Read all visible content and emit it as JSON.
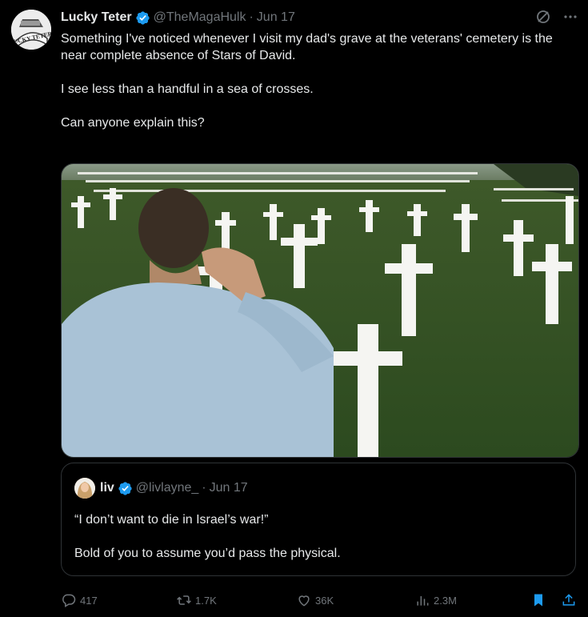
{
  "tweet": {
    "author_name": "Lucky Teter",
    "handle": "@TheMagaHulk",
    "separator": "·",
    "date": "Jun 17",
    "avatar_text": "LUCKY TETER",
    "paragraphs": [
      "Something I've noticed whenever I visit my dad's grave at the veterans' cemetery is the near complete absence of Stars of David.",
      "I see less than a handful in a sea of crosses.",
      "Can anyone explain this?"
    ]
  },
  "quote": {
    "author_name": "liv",
    "handle": "@livlayne_",
    "separator": "·",
    "date": "Jun 17",
    "paragraphs": [
      "“I don’t want to die in Israel’s war!”",
      "Bold of you to assume you’d pass the physical."
    ]
  },
  "actions": {
    "replies": "417",
    "reposts": "1.7K",
    "likes": "36K",
    "views": "2.3M"
  },
  "colors": {
    "background": "#000000",
    "text": "#e7e9ea",
    "muted": "#71767b",
    "accent": "#1d9bf0",
    "border": "#2f3336"
  },
  "icons": [
    "grok-icon",
    "more-icon",
    "verified-icon",
    "reply-icon",
    "repost-icon",
    "like-icon",
    "views-icon",
    "bookmark-icon",
    "share-icon"
  ]
}
